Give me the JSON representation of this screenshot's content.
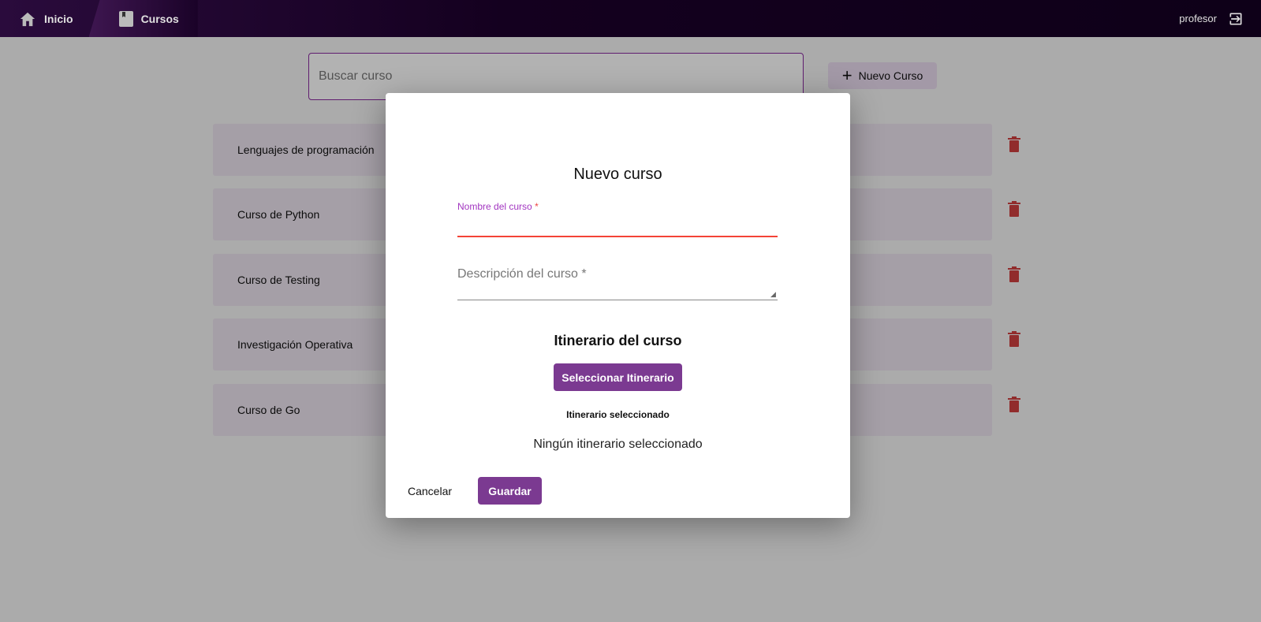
{
  "nav": {
    "items": [
      {
        "label": "Inicio",
        "icon": "home-icon"
      },
      {
        "label": "Cursos",
        "icon": "book-icon"
      }
    ],
    "user": "profesor"
  },
  "search": {
    "placeholder": "Buscar curso"
  },
  "new_course_label": "Nuevo Curso",
  "courses": [
    "Lenguajes de programación",
    "Curso de Python",
    "Curso de Testing",
    "Investigación Operativa",
    "Curso de Go"
  ],
  "modal": {
    "title": "Nuevo curso",
    "name_label": "Nombre del curso",
    "description_label": "Descripción del curso *",
    "itinerary_title": "Itinerario del curso",
    "select_itinerary": "Seleccionar Itinerario",
    "selected_heading": "Itinerario seleccionado",
    "none_selected": "Ningún itinerario seleccionado",
    "cancel": "Cancelar",
    "save": "Guardar"
  },
  "colors": {
    "accent": "#7b3a91",
    "error": "#f44336",
    "trash": "#c0393f"
  }
}
